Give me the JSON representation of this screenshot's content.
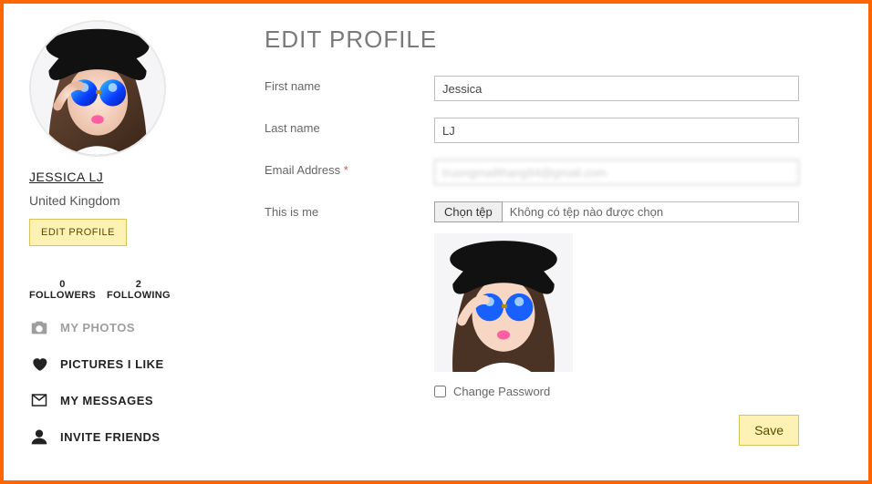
{
  "sidebar": {
    "username": "JESSICA LJ",
    "location": "United Kingdom",
    "edit_profile_label": "EDIT PROFILE",
    "stats": {
      "followers_count": "0",
      "followers_label": "FOLLOWERS",
      "following_count": "2",
      "following_label": "FOLLOWING"
    },
    "nav": {
      "my_photos": "MY PHOTOS",
      "pictures_i_like": "PICTURES I LIKE",
      "my_messages": "MY MESSAGES",
      "invite_friends": "INVITE FRIENDS"
    }
  },
  "main": {
    "title": "EDIT PROFILE",
    "labels": {
      "first_name": "First name",
      "last_name": "Last name",
      "email": "Email Address",
      "email_required": "*",
      "this_is_me": "This is me",
      "change_password": "Change Password"
    },
    "values": {
      "first_name": "Jessica",
      "last_name": "LJ",
      "email": "truongmailthang94@gmail.com"
    },
    "file": {
      "button": "Chọn tệp",
      "placeholder": "Không có tệp nào được chọn"
    },
    "save_label": "Save"
  }
}
